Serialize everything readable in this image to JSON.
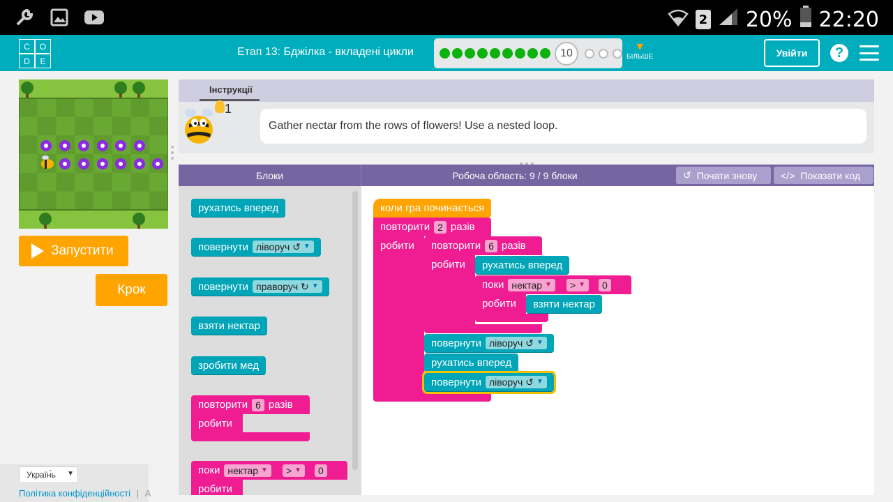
{
  "status_bar": {
    "battery": "20%",
    "time": "22:20",
    "sim": "2"
  },
  "header": {
    "logo_letters": [
      "C",
      "O",
      "D",
      "E"
    ],
    "stage_title": "Етап 13: Бджілка - вкладені цикли",
    "current_level": "10",
    "more_label": "БІЛЬШЕ",
    "signin_label": "Увійти",
    "help_label": "?"
  },
  "controls": {
    "run_label": "Запустити",
    "step_label": "Крок"
  },
  "footer": {
    "language": "Україн́ь",
    "privacy_link": "Політика конфіденційності",
    "separator": "|",
    "next_char": "A"
  },
  "instructions": {
    "tab_label": "Інструкції",
    "text": "Gather nectar from the rows of flowers! Use a nested loop.",
    "hint_count": "1"
  },
  "workspace_header": {
    "toolbox_title": "Блоки",
    "workspace_title": "Робоча область: 9 / 9 блоки",
    "restart_label": "Почати знову",
    "show_code_label": "Показати код"
  },
  "toolbox": {
    "move_forward": "рухатись вперед",
    "turn": "повернути",
    "left": "ліворуч ↺",
    "right": "праворуч ↻",
    "get_nectar": "взяти нектар",
    "make_honey": "зробити мед",
    "repeat": "повторити",
    "repeat_count": "6",
    "times": "разів",
    "do": "робити",
    "while": "поки",
    "nectar": "нектар",
    "gt": ">",
    "zero": "0"
  },
  "workspace": {
    "when_run": "коли гра починається",
    "repeat": "повторити",
    "outer_count": "2",
    "inner_count": "6",
    "times": "разів",
    "do": "робити",
    "move_forward": "рухатись вперед",
    "while": "поки",
    "nectar": "нектар",
    "gt": ">",
    "zero": "0",
    "get_nectar": "взяти нектар",
    "turn": "повернути",
    "left": "ліворуч ↺"
  },
  "colors": {
    "header": "#00adbc",
    "action_block": "#00a5b7",
    "loop_block": "#f01c92",
    "event_block": "#ffa400",
    "run_button": "#ffa400",
    "progress_done": "#0eb20e"
  }
}
